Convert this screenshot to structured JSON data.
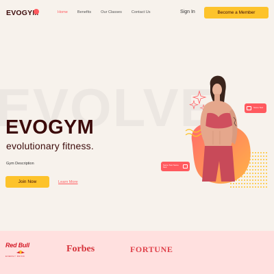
{
  "brand": {
    "name": "EVOGYM",
    "accent": "#ff5a5f",
    "primary": "#fdc32b",
    "dark": "#3b0a0a",
    "background": "#f7f2ec"
  },
  "nav": {
    "links": [
      {
        "label": "Home",
        "active": true
      },
      {
        "label": "Benefits",
        "active": false
      },
      {
        "label": "Our Classes",
        "active": false
      },
      {
        "label": "Contact Us",
        "active": false
      }
    ],
    "signin_label": "Sign In",
    "cta_label": "Become a Member"
  },
  "hero": {
    "watermark": "EVOLVE",
    "title": "EVOGYM",
    "subtitle": "evolutionary fitness.",
    "description": "Gym Description",
    "join_label": "Join Now",
    "learn_more_label": "Learn More"
  },
  "badges": {
    "top": {
      "text": "Some Text",
      "icon": "calendar-icon"
    },
    "left": {
      "text": "Some Text Some Text",
      "icon": "lock-icon"
    }
  },
  "sponsors": {
    "redbull": {
      "name": "Red Bull",
      "tagline": "ENERGY DRINK"
    },
    "forbes": "Forbes",
    "fortune": "FORTUNE"
  }
}
